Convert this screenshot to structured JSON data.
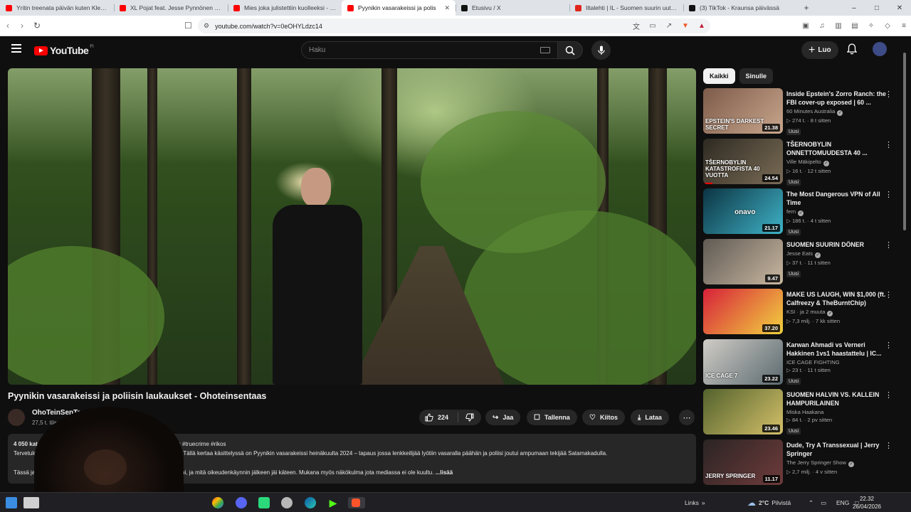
{
  "browser": {
    "tabs": [
      {
        "label": "Yritin treenata päivän kuten Klebio -",
        "color": "#ff0000",
        "active": false
      },
      {
        "label": "XL Pojat feat. Jesse Pynnönen - YouT",
        "color": "#ff0000",
        "active": false
      },
      {
        "label": "Mies joka julistettiin kuolleeksi - mm",
        "color": "#ff0000",
        "active": false
      },
      {
        "label": "Pyynikin vasarakeissi ja polis",
        "color": "#ff0000",
        "active": true
      },
      {
        "label": "Etusivu / X",
        "color": "#111111",
        "active": false
      },
      {
        "label": "Iltalehti | IL - Suomen suurin uutispa",
        "color": "#e0261b",
        "active": false
      },
      {
        "label": "(3) TikTok - Kraunsa päivässä",
        "color": "#111111",
        "active": false
      }
    ],
    "new_tab": "+",
    "url": "youtube.com/watch?v=0eOHYLdzc14"
  },
  "youtube": {
    "logo_text": "YouTube",
    "country_code": "FI",
    "search_placeholder": "Haku",
    "create_label": "Luo"
  },
  "video": {
    "title": "Pyynikin vasarakeissi ja poliisin laukaukset - Ohoteinsentaas",
    "channel": "OhoTeinSenTaas",
    "subscribers": "27,5 t. tilaajaa",
    "likes": "224",
    "share_label": "Jaa",
    "save_label": "Tallenna",
    "thanks_label": "Kiitos",
    "download_label": "Lataa",
    "description": {
      "stats": "4 050 katselukertaa",
      "hashtags": "#as #truecrime #rikos",
      "line1_start": "Tervetuloa Oho",
      "line1_end": "jaksoon. Tällä kertaa käsittelyssä on Pyynikin vasarakeissi heinäkuulta 2024 – tapaus jossa lenkkeilijää lyötiin vasaralla päähän ja poliisi joutui ampumaan tekijää Satamakadulla.",
      "line2_start": "Tässä jakso",
      "line2_end": "eteni, ja mitä oikeudenkäynnin jälkeen jäi käteen. Mukana myös näkökulma jota mediassa ei ole kuultu.",
      "more": "...lisää"
    }
  },
  "sidebar": {
    "chips": [
      "Kaikki",
      "Sinulle"
    ],
    "recommendations": [
      {
        "title": "Inside Epstein's Zorro Ranch: the FBI cover-up exposed | 60 ...",
        "channel": "60 Minutes Australia",
        "verified": true,
        "meta": "274 t. · 8 t sitten",
        "badge": "Uusi",
        "duration": "21.38",
        "thumb_text": "EPSTEIN'S DARKEST SECRET",
        "thumb_colors": [
          "#7d5b4a",
          "#c8a68c"
        ],
        "progress": 0
      },
      {
        "title": "TŠERNOBYLIN ONNETTOMUUDESTA 40 ...",
        "channel": "Ville Mäkipelto",
        "verified": true,
        "meta": "16 t. · 12 t sitten",
        "badge": "Uusi",
        "duration": "24.54",
        "thumb_text": "TŠERNOBYLIN KATASTROFISTA 40 VUOTTA",
        "thumb_colors": [
          "#2e2a22",
          "#7a6c56"
        ],
        "progress": 0.12
      },
      {
        "title": "The Most Dangerous VPN of All Time",
        "channel": "fern",
        "verified": true,
        "meta": "186 t. · 4 t sitten",
        "badge": "Uusi",
        "duration": "21.17",
        "thumb_text": "onavo",
        "thumb_colors": [
          "#0c3442",
          "#3fb3c7"
        ],
        "progress": 0
      },
      {
        "title": "SUOMEN SUURIN DÖNER",
        "channel": "Jesse Eats",
        "verified": true,
        "meta": "37 t. · 11 t sitten",
        "badge": "Uusi",
        "duration": "9.47",
        "thumb_text": "",
        "thumb_colors": [
          "#5f5a54",
          "#c9b7a0"
        ],
        "progress": 0
      },
      {
        "title": "MAKE US LAUGH, WIN $1,000 (ft. Calfreezy & TheBurntChip)",
        "channel": "KSI · ja 2 muuta",
        "verified": true,
        "meta": "7,3 milj. · 7 kk sitten",
        "badge": "",
        "duration": "37.20",
        "thumb_text": "",
        "thumb_colors": [
          "#d7213a",
          "#f2d23f"
        ],
        "progress": 0
      },
      {
        "title": "Karwan Ahmadi vs Verneri Hakkinen 1vs1 haastattelu | IC...",
        "channel": "ICE CAGE FIGHTING",
        "verified": false,
        "meta": "23 t. · 11 t sitten",
        "badge": "Uusi",
        "duration": "23.22",
        "thumb_text": "ICE CAGE 7",
        "thumb_colors": [
          "#d0ccc6",
          "#5b6a70"
        ],
        "progress": 0
      },
      {
        "title": "SUOMEN HALVIN VS. KALLEIN HAMPURILAINEN",
        "channel": "Miska Haakana",
        "verified": false,
        "meta": "84 t. · 2 pv sitten",
        "badge": "Uusi",
        "duration": "23.46",
        "thumb_text": "",
        "thumb_colors": [
          "#52622c",
          "#d4c06a"
        ],
        "progress": 0
      },
      {
        "title": "Dude, Try A Transsexual | Jerry Springer",
        "channel": "The Jerry Springer Show",
        "verified": true,
        "meta": "2,7 milj. · 4 v sitten",
        "badge": "",
        "duration": "11.17",
        "thumb_text": "JERRY SPRINGER",
        "thumb_colors": [
          "#2b2424",
          "#6f3b3b"
        ],
        "progress": 0
      }
    ]
  },
  "taskbar": {
    "links": "Links",
    "temperature": "2°C",
    "weather": "Pilvistä",
    "language": "ENG",
    "time": "22.32",
    "date": "26/04/2026"
  }
}
